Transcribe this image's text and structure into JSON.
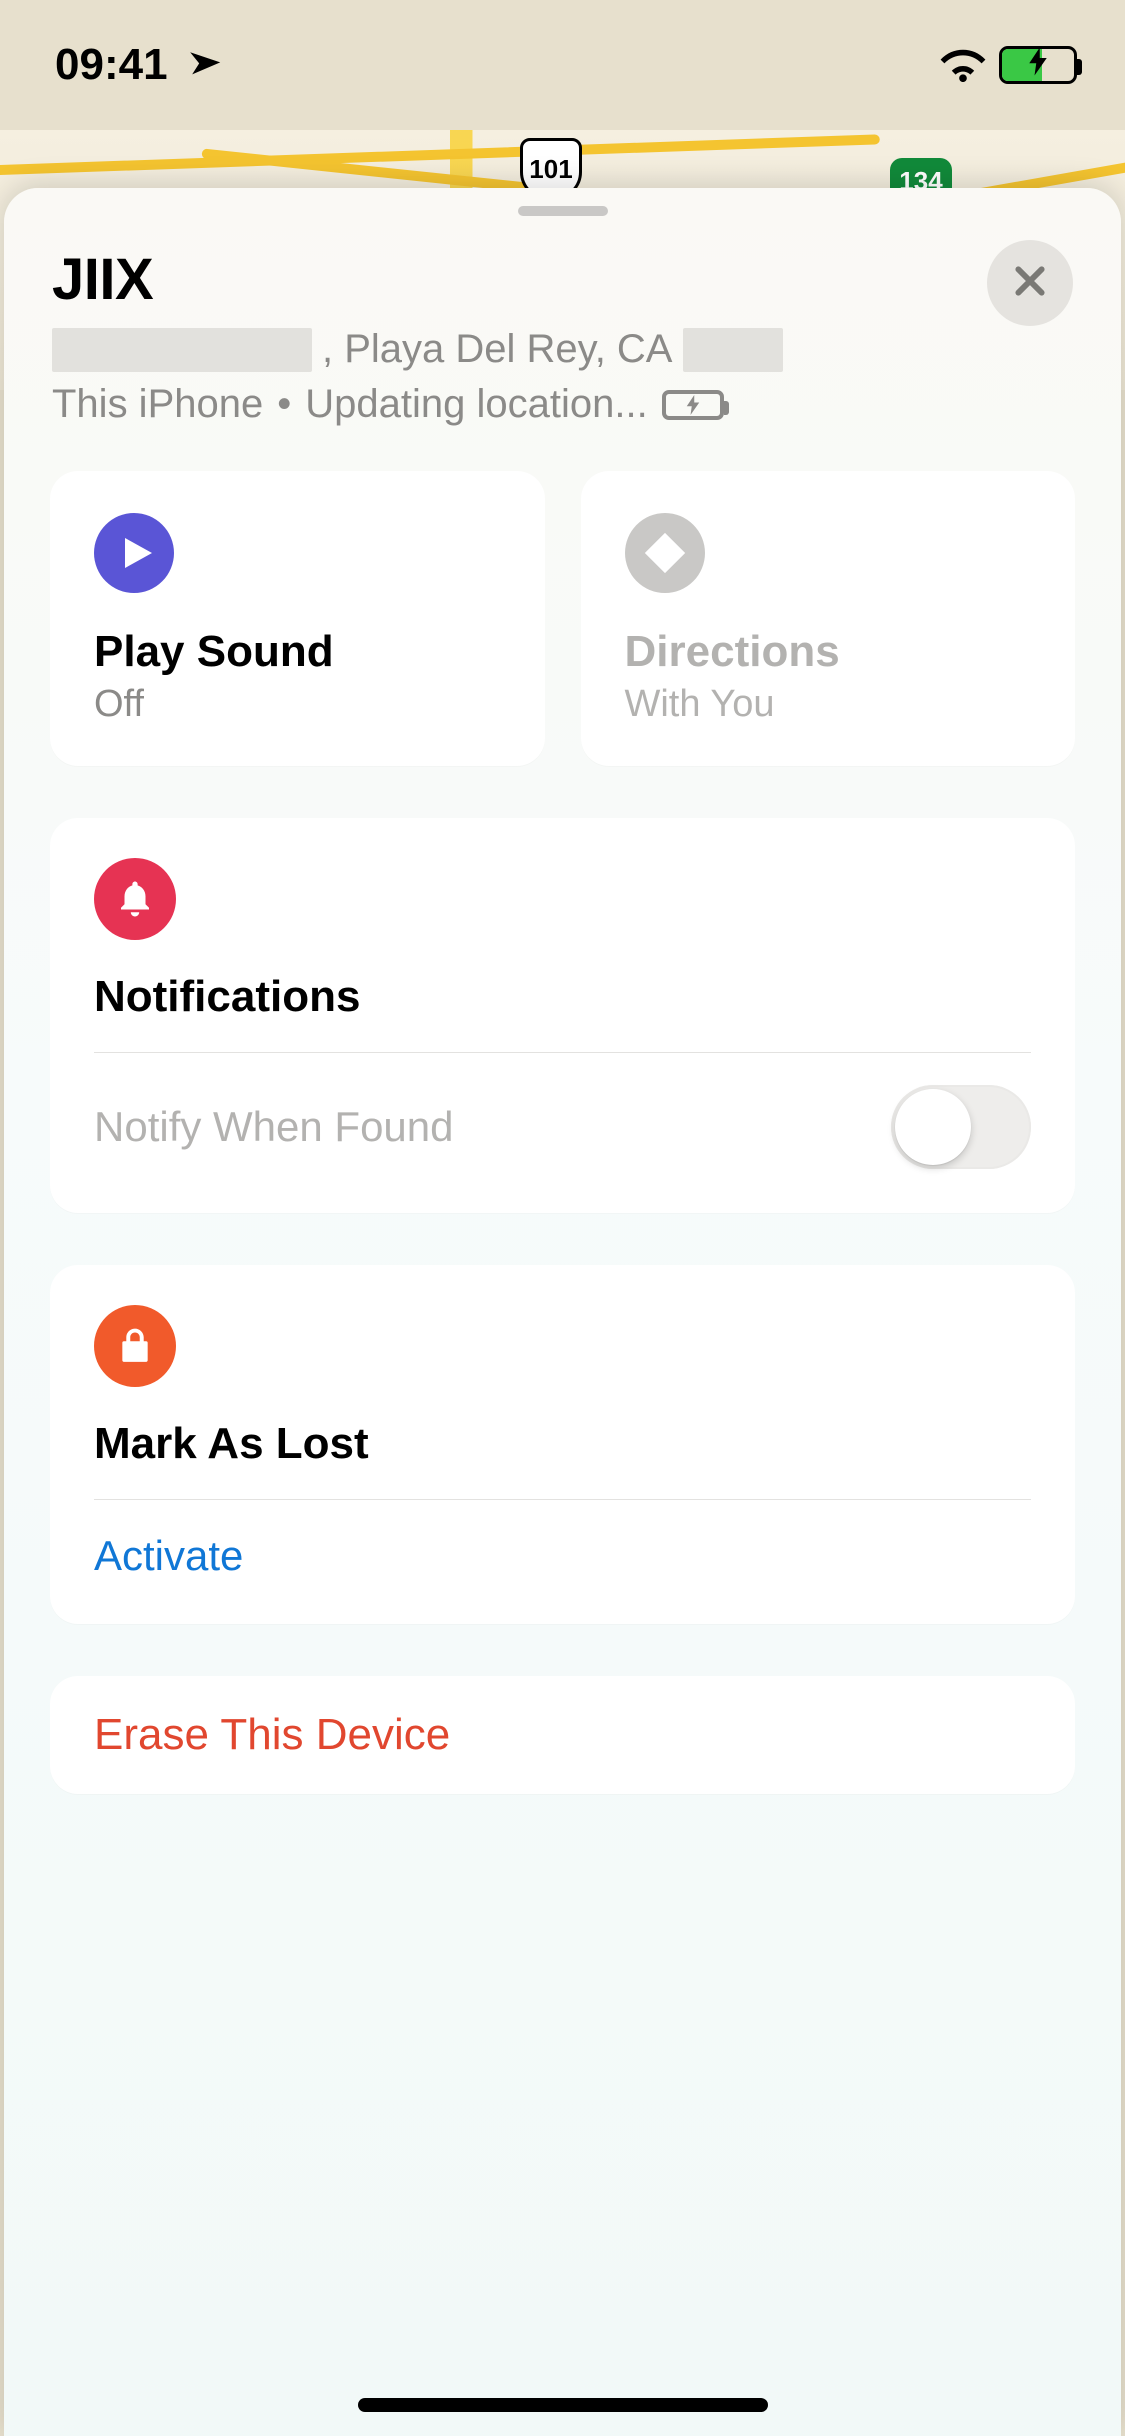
{
  "status_bar": {
    "time": "09:41"
  },
  "map": {
    "shield_us": "101",
    "shield_ca": "134"
  },
  "header": {
    "device_name": "JIIX",
    "address_visible": ", Playa Del Rey, CA",
    "status_device": "This iPhone",
    "status_sep": "•",
    "status_updating": "Updating location..."
  },
  "tiles": {
    "play_sound": {
      "title": "Play Sound",
      "sub": "Off"
    },
    "directions": {
      "title": "Directions",
      "sub": "With You"
    }
  },
  "notifications": {
    "title": "Notifications",
    "notify_when_found": "Notify When Found",
    "toggle_on": false
  },
  "mark_lost": {
    "title": "Mark As Lost",
    "activate": "Activate"
  },
  "erase": {
    "label": "Erase This Device"
  }
}
